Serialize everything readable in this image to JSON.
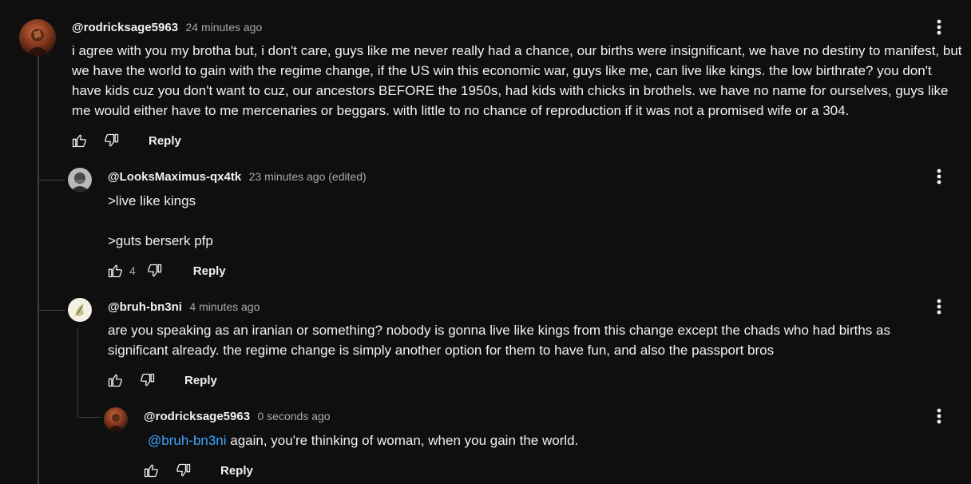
{
  "comments": [
    {
      "handle": "@rodricksage5963",
      "time": "24 minutes ago",
      "text": "i agree with you my brotha but,  i don't care, guys like me never really had a chance, our births were insignificant, we have no destiny to manifest, but we have the world to gain with the regime change, if the US win this economic war, guys like me, can live like kings. the low birthrate? you don't have kids cuz you don't want to cuz, our ancestors BEFORE the 1950s, had kids with chicks in brothels. we have no name for ourselves, guys like me would either have to me mercenaries or beggars. with little to no chance of reproduction if it was not a promised wife or a 304.",
      "likes": "",
      "reply_label": "Reply"
    },
    {
      "handle": "@LooksMaximus-qx4tk",
      "time": "23 minutes ago (edited)",
      "line1": ">live like kings",
      "line2": ">guts berserk pfp",
      "likes": "4",
      "reply_label": "Reply"
    },
    {
      "handle": "@bruh-bn3ni",
      "time": "4 minutes ago",
      "text": "are you speaking as an iranian or something? nobody is gonna live like kings from this change except the chads who had births as significant already. the regime change is simply another option for them to have fun, and also the passport bros",
      "likes": "",
      "reply_label": "Reply"
    },
    {
      "handle": "@rodricksage5963",
      "time": "0 seconds ago",
      "mention": "@bruh-bn3ni",
      "text": " again, you're thinking of woman, when you gain the world.",
      "likes": "",
      "reply_label": "Reply"
    }
  ],
  "icons": {
    "like": "thumbs-up-icon",
    "dislike": "thumbs-down-icon",
    "more": "more-vert-icon"
  },
  "colors": {
    "background": "#0f0f0f",
    "text": "#f1f1f1",
    "secondary": "#aaaaaa",
    "mention": "#3ea6ff",
    "thread_line": "#3f3f3f"
  }
}
